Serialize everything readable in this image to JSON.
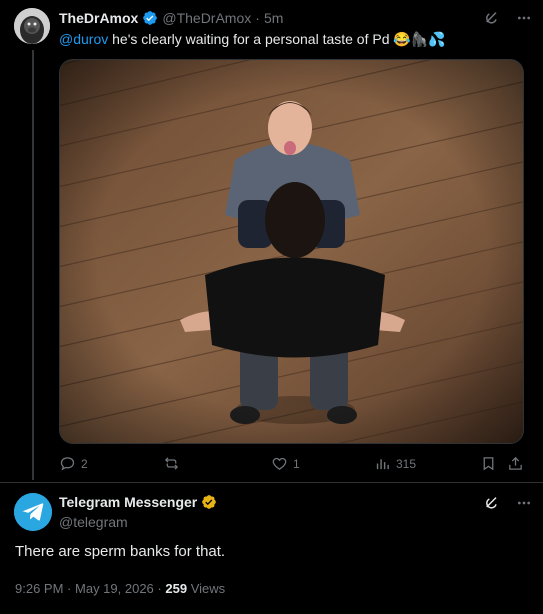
{
  "tweet1": {
    "display_name": "TheDrAmox",
    "handle": "@TheDrAmox",
    "separator": "·",
    "time": "5m",
    "mention": "@durov",
    "text": " he's clearly waiting for a personal taste of Pd",
    "emoji": "😂🦍💦",
    "media_icon": "photo",
    "actions": {
      "reply_count": "2",
      "repost_count": "",
      "like_count": "1",
      "views_count": "315"
    },
    "icons": [
      "grok-icon",
      "more-icon",
      "reply-icon",
      "repost-icon",
      "like-icon",
      "views-icon",
      "bookmark-icon",
      "share-icon"
    ]
  },
  "tweet2": {
    "display_name": "Telegram Messenger",
    "handle": "@telegram",
    "text": "There are sperm banks for that.",
    "time": "9:26 PM",
    "dot": "·",
    "date": "May 19, 2026",
    "views_count": "259",
    "views_label": "Views"
  },
  "colors": {
    "background": "#000000",
    "accent": "#1d9bf0",
    "muted": "#71767b",
    "divider": "#2f3336",
    "gold_badge": "#e7b416",
    "telegram": "#2aa6e0"
  }
}
